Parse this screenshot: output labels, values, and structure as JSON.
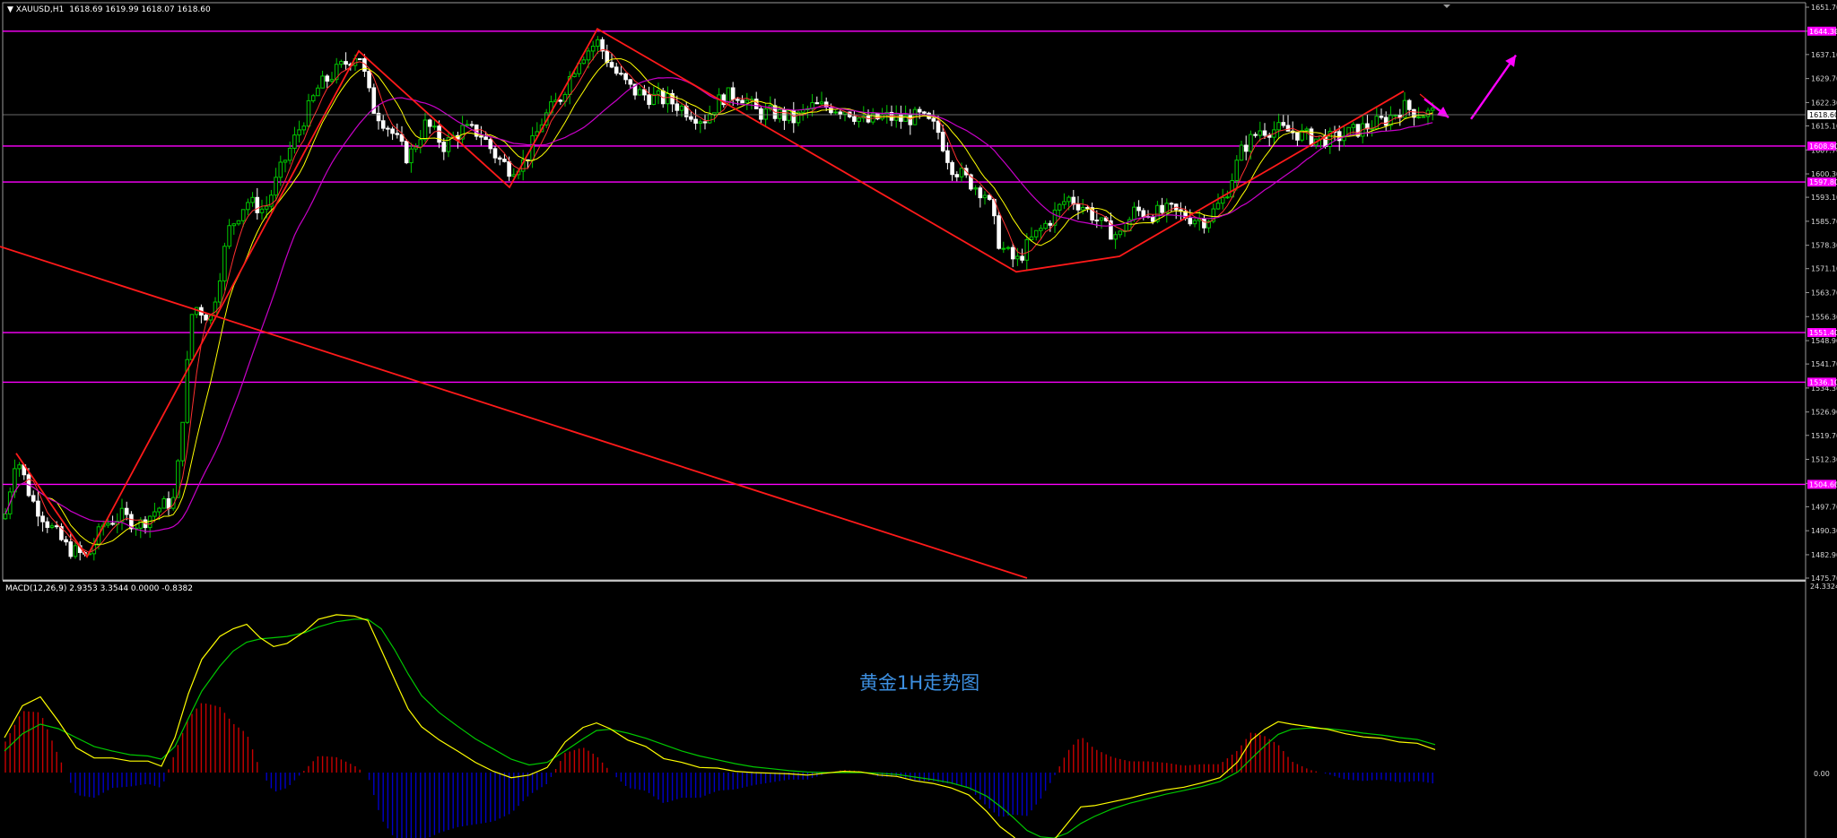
{
  "header": {
    "symbol": "XAUUSD,H1",
    "ohlc": "1618.69 1619.99 1618.07 1618.60"
  },
  "macd_header": "MACD(12,26,9) 2.9353 3.3544 0.0000 -0.8382",
  "watermark": "黄金1H走势图",
  "colors": {
    "background": "#000000",
    "bull_candle": "#00c800",
    "bear_candle": "#ffffff",
    "support_resistance": "#ff00ff",
    "trendline": "#ff1a1a",
    "ma_fast": "#ffff00",
    "ma_slow": "#c800c8",
    "macd_line": "#ffff00",
    "signal_line": "#00c800",
    "hist_pos": "#c80000",
    "hist_neg": "#0000c8",
    "arrow": "#ff00ff",
    "watermark": "#3d8fe0"
  },
  "chart_data": [
    {
      "type": "candlestick",
      "symbol": "XAUUSD",
      "timeframe": "H1",
      "ylim": [
        1475.7,
        1651.7
      ],
      "price_ticks": [
        "1651.70",
        "1644.30",
        "1637.10",
        "1629.70",
        "1622.30",
        "1615.10",
        "1607.70",
        "1600.30",
        "1593.10",
        "1585.70",
        "1578.30",
        "1571.10",
        "1563.70",
        "1556.30",
        "1548.90",
        "1541.70",
        "1534.30",
        "1526.90",
        "1519.70",
        "1512.30",
        "1504.90",
        "1497.70",
        "1490.30",
        "1482.90",
        "1475.70"
      ],
      "current_price": "1618.60",
      "horizontal_levels": [
        1644.3,
        1608.9,
        1597.8,
        1551.4,
        1536.1,
        1504.6
      ],
      "level_labels": [
        "1644.30",
        "1608.90",
        "1597.80",
        "1551.40",
        "1536.10",
        "1504.60"
      ],
      "trendlines": [
        {
          "from": [
            0,
            1577.9
          ],
          "to": [
            1145,
            1475.7
          ]
        }
      ],
      "zigzag_pivots": [
        [
          18,
          1514.2
        ],
        [
          97,
          1482.3
        ],
        [
          400,
          1638.2
        ],
        [
          568,
          1596.2
        ],
        [
          666,
          1645.0
        ],
        [
          1133,
          1570.1
        ],
        [
          1248,
          1574.9
        ],
        [
          1565,
          1625.8
        ]
      ],
      "zigzag_tail": [
        [
          1583,
          1624.9
        ],
        [
          1615,
          1617.7
        ]
      ],
      "arrows": [
        {
          "from": [
            1640,
            1617.2
          ],
          "to": [
            1690,
            1636.9
          ],
          "direction": "up"
        },
        {
          "from": [
            1588,
            1623.4
          ],
          "to": [
            1615,
            1617.7
          ],
          "direction": "down"
        }
      ],
      "price_path": [
        [
          5,
          1494
        ],
        [
          18,
          1514
        ],
        [
          35,
          1500
        ],
        [
          55,
          1492
        ],
        [
          75,
          1485
        ],
        [
          97,
          1482
        ],
        [
          115,
          1492
        ],
        [
          135,
          1495
        ],
        [
          155,
          1492
        ],
        [
          175,
          1497
        ],
        [
          195,
          1500
        ],
        [
          215,
          1560
        ],
        [
          235,
          1556
        ],
        [
          255,
          1583
        ],
        [
          275,
          1592
        ],
        [
          295,
          1589
        ],
        [
          315,
          1603
        ],
        [
          335,
          1615
        ],
        [
          355,
          1627
        ],
        [
          375,
          1632
        ],
        [
          400,
          1638
        ],
        [
          415,
          1621
        ],
        [
          435,
          1614
        ],
        [
          455,
          1605
        ],
        [
          475,
          1616
        ],
        [
          495,
          1609
        ],
        [
          515,
          1614
        ],
        [
          535,
          1613
        ],
        [
          555,
          1605
        ],
        [
          568,
          1602
        ],
        [
          585,
          1604
        ],
        [
          605,
          1617
        ],
        [
          625,
          1624
        ],
        [
          645,
          1636
        ],
        [
          666,
          1641
        ],
        [
          685,
          1632
        ],
        [
          705,
          1626
        ],
        [
          725,
          1624
        ],
        [
          745,
          1623
        ],
        [
          765,
          1620
        ],
        [
          785,
          1617
        ],
        [
          805,
          1624
        ],
        [
          825,
          1625
        ],
        [
          845,
          1619
        ],
        [
          865,
          1619
        ],
        [
          885,
          1617
        ],
        [
          905,
          1621
        ],
        [
          925,
          1621
        ],
        [
          945,
          1620
        ],
        [
          965,
          1616
        ],
        [
          985,
          1618
        ],
        [
          1005,
          1617
        ],
        [
          1025,
          1618
        ],
        [
          1045,
          1614
        ],
        [
          1060,
          1603
        ],
        [
          1080,
          1598
        ],
        [
          1100,
          1594
        ],
        [
          1115,
          1578
        ],
        [
          1133,
          1573
        ],
        [
          1150,
          1580
        ],
        [
          1170,
          1586
        ],
        [
          1190,
          1593
        ],
        [
          1210,
          1590
        ],
        [
          1230,
          1584
        ],
        [
          1248,
          1581
        ],
        [
          1265,
          1589
        ],
        [
          1285,
          1588
        ],
        [
          1305,
          1589
        ],
        [
          1325,
          1587
        ],
        [
          1345,
          1586
        ],
        [
          1365,
          1593
        ],
        [
          1385,
          1608
        ],
        [
          1405,
          1614
        ],
        [
          1425,
          1614
        ],
        [
          1445,
          1613
        ],
        [
          1465,
          1611
        ],
        [
          1485,
          1611
        ],
        [
          1505,
          1613
        ],
        [
          1525,
          1615
        ],
        [
          1545,
          1617
        ],
        [
          1565,
          1621
        ],
        [
          1583,
          1619
        ],
        [
          1600,
          1619
        ]
      ]
    },
    {
      "type": "macd",
      "params": "12,26,9",
      "values": {
        "macd": 2.9353,
        "signal": 3.3544,
        "third": 0.0,
        "fourth": -0.8382
      },
      "y_ticks": [
        "24.3324",
        "0.00"
      ],
      "macd_line": [
        [
          5,
          5.5
        ],
        [
          25,
          10.5
        ],
        [
          45,
          11.9
        ],
        [
          65,
          8.1
        ],
        [
          85,
          3.9
        ],
        [
          105,
          2.3
        ],
        [
          125,
          2.3
        ],
        [
          145,
          1.8
        ],
        [
          165,
          1.8
        ],
        [
          180,
          1.0
        ],
        [
          195,
          5.5
        ],
        [
          210,
          12.4
        ],
        [
          225,
          17.8
        ],
        [
          245,
          21.4
        ],
        [
          260,
          22.6
        ],
        [
          275,
          23.3
        ],
        [
          290,
          21.2
        ],
        [
          305,
          19.8
        ],
        [
          320,
          20.3
        ],
        [
          340,
          22.2
        ],
        [
          355,
          24.1
        ],
        [
          375,
          24.8
        ],
        [
          395,
          24.6
        ],
        [
          410,
          23.9
        ],
        [
          425,
          19.3
        ],
        [
          440,
          14.6
        ],
        [
          455,
          10.0
        ],
        [
          470,
          7.2
        ],
        [
          490,
          5.1
        ],
        [
          510,
          3.4
        ],
        [
          530,
          1.6
        ],
        [
          550,
          0.2
        ],
        [
          570,
          -0.8
        ],
        [
          590,
          -0.4
        ],
        [
          610,
          0.8
        ],
        [
          630,
          4.8
        ],
        [
          650,
          7.1
        ],
        [
          665,
          7.8
        ],
        [
          680,
          6.9
        ],
        [
          700,
          5.1
        ],
        [
          720,
          4.1
        ],
        [
          740,
          2.2
        ],
        [
          760,
          1.6
        ],
        [
          780,
          0.8
        ],
        [
          800,
          0.7
        ],
        [
          820,
          0.2
        ],
        [
          840,
          0.0
        ],
        [
          860,
          -0.1
        ],
        [
          880,
          -0.2
        ],
        [
          900,
          -0.4
        ],
        [
          920,
          -0.1
        ],
        [
          940,
          0.2
        ],
        [
          960,
          0.1
        ],
        [
          980,
          -0.4
        ],
        [
          1000,
          -0.6
        ],
        [
          1020,
          -1.3
        ],
        [
          1040,
          -1.7
        ],
        [
          1060,
          -2.4
        ],
        [
          1080,
          -3.5
        ],
        [
          1100,
          -6.1
        ],
        [
          1115,
          -8.5
        ],
        [
          1130,
          -10.1
        ],
        [
          1145,
          -12.2
        ],
        [
          1160,
          -12.0
        ],
        [
          1175,
          -10.6
        ],
        [
          1190,
          -8.0
        ],
        [
          1205,
          -5.4
        ],
        [
          1220,
          -5.2
        ],
        [
          1240,
          -4.6
        ],
        [
          1260,
          -4.0
        ],
        [
          1280,
          -3.3
        ],
        [
          1300,
          -2.7
        ],
        [
          1320,
          -2.3
        ],
        [
          1340,
          -1.6
        ],
        [
          1360,
          -0.8
        ],
        [
          1380,
          1.7
        ],
        [
          1395,
          5.1
        ],
        [
          1410,
          6.8
        ],
        [
          1425,
          8.0
        ],
        [
          1440,
          7.6
        ],
        [
          1460,
          7.2
        ],
        [
          1480,
          6.8
        ],
        [
          1500,
          6.1
        ],
        [
          1520,
          5.6
        ],
        [
          1540,
          5.4
        ],
        [
          1560,
          4.8
        ],
        [
          1580,
          4.6
        ],
        [
          1600,
          3.6
        ]
      ],
      "signal_line": [
        [
          5,
          3.4
        ],
        [
          25,
          6.1
        ],
        [
          45,
          7.6
        ],
        [
          65,
          6.9
        ],
        [
          85,
          5.5
        ],
        [
          105,
          4.1
        ],
        [
          125,
          3.4
        ],
        [
          145,
          2.8
        ],
        [
          165,
          2.6
        ],
        [
          180,
          2.1
        ],
        [
          195,
          4.1
        ],
        [
          210,
          8.5
        ],
        [
          225,
          12.8
        ],
        [
          245,
          16.7
        ],
        [
          260,
          19.1
        ],
        [
          275,
          20.5
        ],
        [
          290,
          21.0
        ],
        [
          305,
          21.2
        ],
        [
          320,
          21.4
        ],
        [
          340,
          22.0
        ],
        [
          355,
          22.9
        ],
        [
          375,
          23.7
        ],
        [
          395,
          24.1
        ],
        [
          410,
          24.1
        ],
        [
          425,
          22.6
        ],
        [
          440,
          19.3
        ],
        [
          455,
          15.5
        ],
        [
          470,
          12.1
        ],
        [
          490,
          9.4
        ],
        [
          510,
          7.3
        ],
        [
          530,
          5.3
        ],
        [
          550,
          3.7
        ],
        [
          570,
          2.1
        ],
        [
          590,
          1.2
        ],
        [
          610,
          1.6
        ],
        [
          630,
          3.4
        ],
        [
          650,
          5.3
        ],
        [
          665,
          6.6
        ],
        [
          680,
          6.8
        ],
        [
          700,
          6.2
        ],
        [
          720,
          5.4
        ],
        [
          740,
          4.4
        ],
        [
          760,
          3.4
        ],
        [
          780,
          2.6
        ],
        [
          800,
          2.0
        ],
        [
          820,
          1.4
        ],
        [
          840,
          0.9
        ],
        [
          860,
          0.6
        ],
        [
          880,
          0.3
        ],
        [
          900,
          0.1
        ],
        [
          920,
          0.0
        ],
        [
          940,
          0.0
        ],
        [
          960,
          0.0
        ],
        [
          980,
          -0.1
        ],
        [
          1000,
          -0.3
        ],
        [
          1020,
          -0.7
        ],
        [
          1040,
          -1.1
        ],
        [
          1060,
          -1.6
        ],
        [
          1080,
          -2.4
        ],
        [
          1100,
          -3.7
        ],
        [
          1115,
          -5.3
        ],
        [
          1130,
          -7.1
        ],
        [
          1145,
          -9.1
        ],
        [
          1160,
          -10.1
        ],
        [
          1175,
          -10.3
        ],
        [
          1190,
          -9.5
        ],
        [
          1205,
          -8.0
        ],
        [
          1220,
          -6.9
        ],
        [
          1240,
          -5.7
        ],
        [
          1260,
          -4.8
        ],
        [
          1280,
          -4.1
        ],
        [
          1300,
          -3.4
        ],
        [
          1320,
          -2.8
        ],
        [
          1340,
          -2.2
        ],
        [
          1360,
          -1.4
        ],
        [
          1380,
          0.1
        ],
        [
          1395,
          2.2
        ],
        [
          1410,
          4.2
        ],
        [
          1425,
          6.0
        ],
        [
          1440,
          6.8
        ],
        [
          1460,
          7.0
        ],
        [
          1480,
          6.9
        ],
        [
          1500,
          6.6
        ],
        [
          1520,
          6.2
        ],
        [
          1540,
          5.9
        ],
        [
          1560,
          5.5
        ],
        [
          1580,
          5.2
        ],
        [
          1600,
          4.4
        ]
      ]
    }
  ]
}
